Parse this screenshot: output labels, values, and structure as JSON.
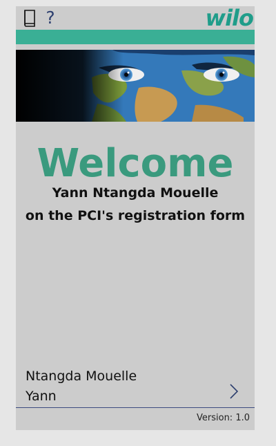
{
  "header": {
    "book_icon": "book-icon",
    "help_icon": "help-icon",
    "help_glyph": "?",
    "logo_text": "wilo"
  },
  "hero": {
    "image": "world-face-banner"
  },
  "welcome": {
    "title": "Welcome",
    "user_name": "Yann Ntangda Mouelle",
    "subtitle": "on the PCI's registration form"
  },
  "user_card": {
    "last_name": "Ntangda Mouelle",
    "first_name": "Yann",
    "chevron_icon": "chevron-right-icon"
  },
  "footer": {
    "version": "Version: 1.0"
  },
  "colors": {
    "accent": "#3aaf95",
    "logo": "#1f9d8a",
    "welcome": "#3a9a7e",
    "panel": "#cccccc",
    "page": "#e6e6e6",
    "divider": "#3c4a80"
  }
}
